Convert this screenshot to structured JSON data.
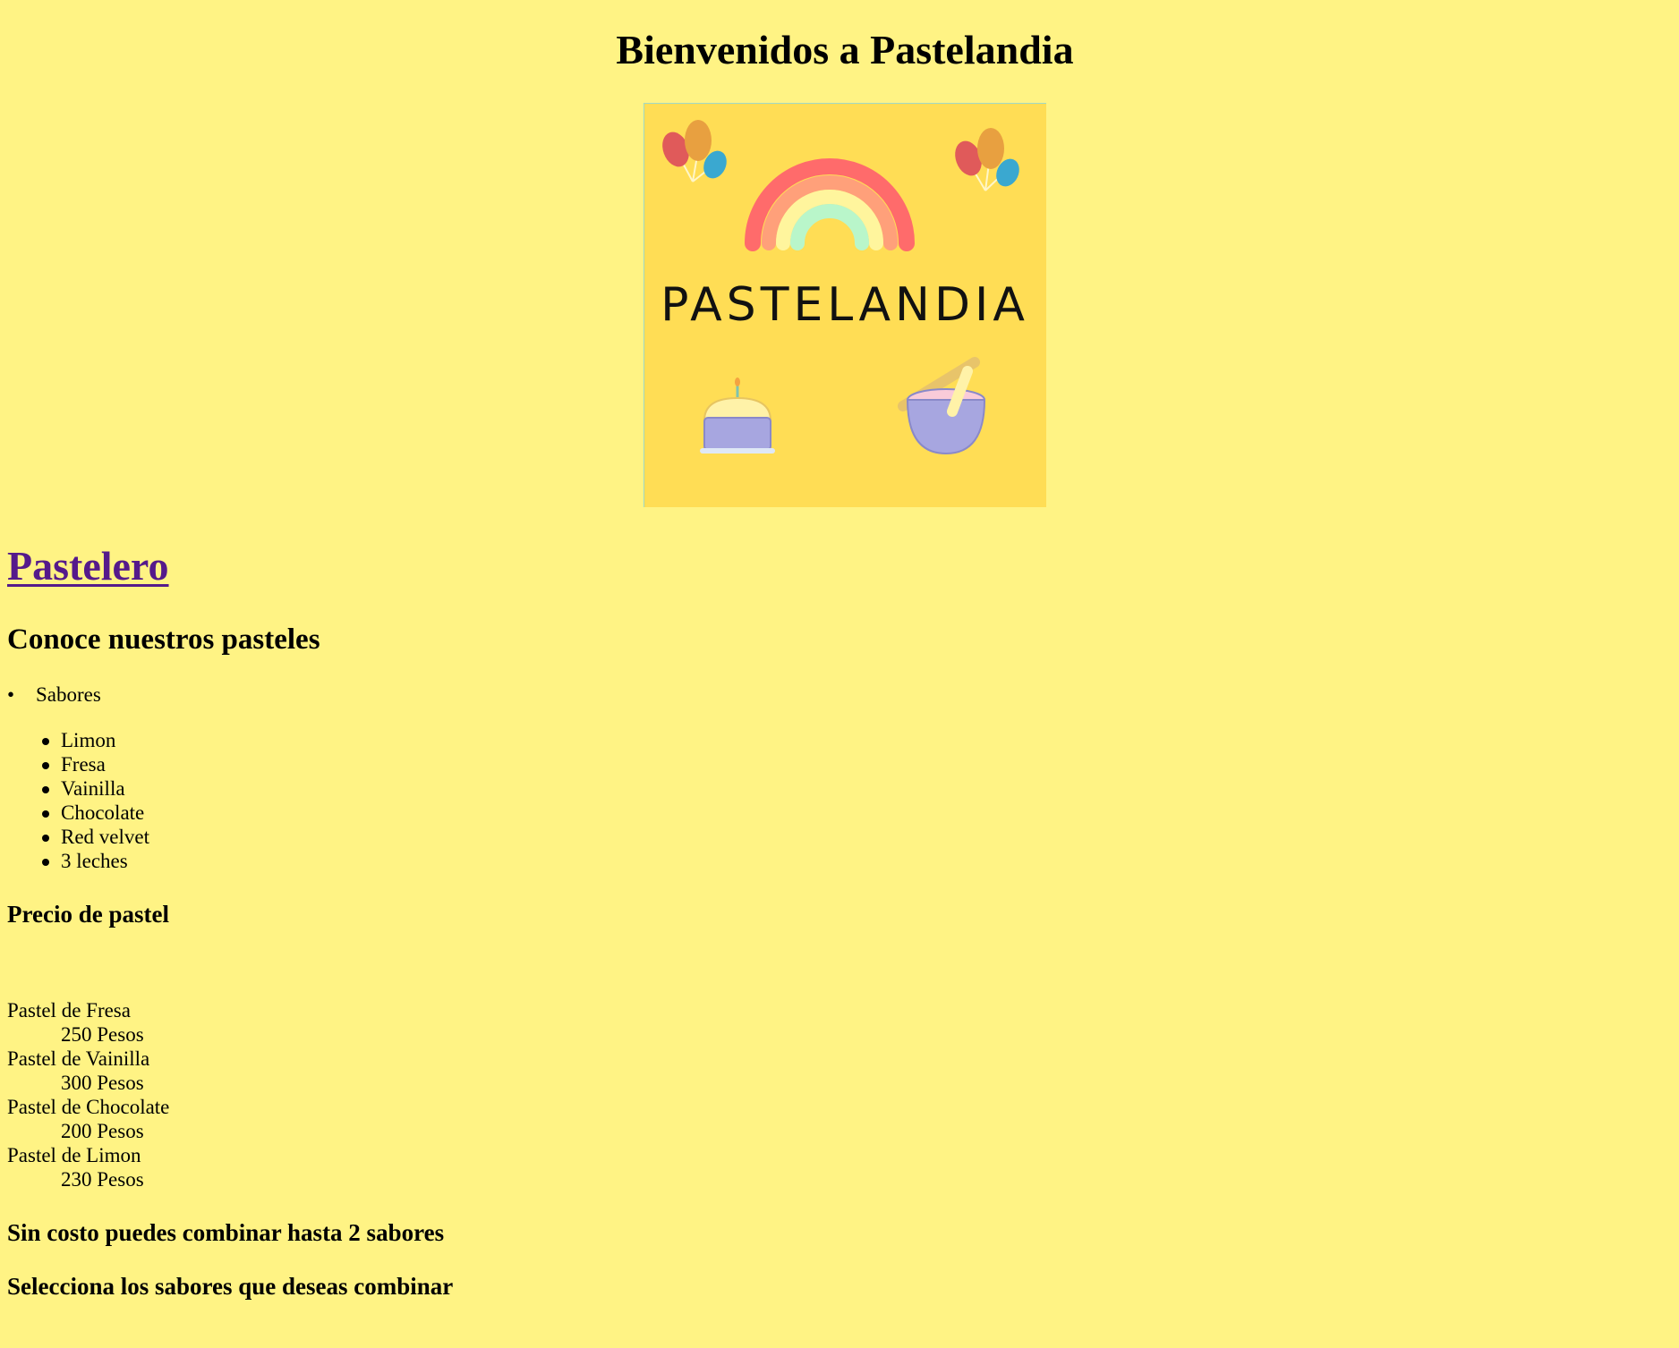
{
  "header": {
    "title": "Bienvenidos a Pastelandia"
  },
  "logo": {
    "brand_text": "PASTELANDIA",
    "colors": {
      "background": "#ffdd55",
      "rainbow_outer": "#ff6b6b",
      "rainbow_mid1": "#ffa07a",
      "rainbow_mid2": "#fff59d",
      "rainbow_inner": "#b9f6ca",
      "balloon_red": "#e05a5a",
      "balloon_orange": "#e8a040",
      "balloon_blue": "#3aa8d0",
      "cake_purple": "#a7a6e0",
      "bowl_pink": "#f9cbd9"
    }
  },
  "nav": {
    "pastelero_link": "Pastelero"
  },
  "cakes": {
    "heading": "Conoce nuestros pasteles",
    "sabores_label": "Sabores",
    "flavors": [
      "Limon",
      "Fresa",
      "Vainilla",
      "Chocolate",
      "Red velvet",
      "3 leches"
    ]
  },
  "prices": {
    "heading": "Precio de pastel",
    "items": [
      {
        "name": "Pastel de Fresa",
        "price": "250 Pesos"
      },
      {
        "name": "Pastel de Vainilla",
        "price": "300 Pesos"
      },
      {
        "name": "Pastel de Chocolate",
        "price": "200 Pesos"
      },
      {
        "name": "Pastel de Limon",
        "price": "230 Pesos"
      }
    ]
  },
  "combine": {
    "note": "Sin costo puedes combinar hasta 2 sabores",
    "prompt": "Selecciona los sabores que deseas combinar"
  },
  "theme": {
    "page_background": "#fff384",
    "link_color": "#551a8b"
  }
}
